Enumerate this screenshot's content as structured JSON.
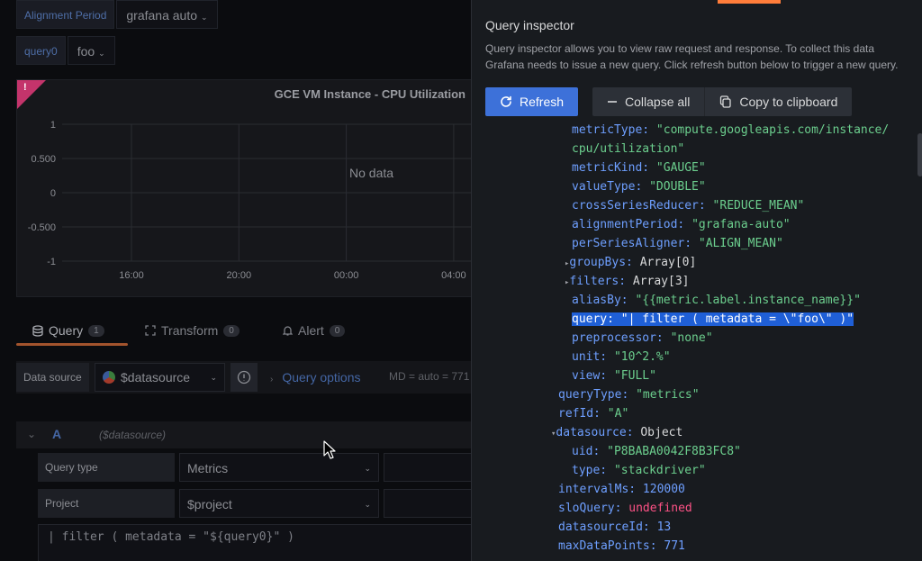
{
  "variables": {
    "alignment_label": "Alignment Period",
    "alignment_value": "grafana auto",
    "query_label": "query0",
    "query_value": "foo"
  },
  "panel": {
    "title": "GCE VM Instance - CPU Utilization",
    "corner_mark": "!",
    "no_data": "No data",
    "y_ticks": [
      "1",
      "0.500",
      "0",
      "-0.500",
      "-1"
    ],
    "x_ticks": [
      "16:00",
      "20:00",
      "00:00",
      "04:00"
    ]
  },
  "editor_tabs": [
    {
      "label": "Query",
      "count": "1"
    },
    {
      "label": "Transform",
      "count": "0"
    },
    {
      "label": "Alert",
      "count": "0"
    }
  ],
  "datasource_row": {
    "label": "Data source",
    "value": "$datasource",
    "query_options": "Query options",
    "meta": "MD = auto = 771"
  },
  "query_row": {
    "ref": "A",
    "datasource": "($datasource)",
    "query_type_label": "Query type",
    "query_type_value": "Metrics",
    "project_label": "Project",
    "project_value": "$project",
    "code": "| filter ( metadata = \"${query0}\" )"
  },
  "inspector": {
    "title": "Query inspector",
    "description": "Query inspector allows you to view raw request and response. To collect this data Grafana needs to issue a new query. Click refresh button below to trigger a new query.",
    "refresh_label": "Refresh",
    "collapse_label": "Collapse all",
    "copy_label": "Copy to clipboard",
    "accent_color": "#3d71d9"
  },
  "json_lines": [
    {
      "indent": 1,
      "key": "metricType",
      "value": "\"compute.googleapis.com/instance/",
      "type": "s"
    },
    {
      "indent": 1,
      "key": "",
      "value": "cpu/utilization\"",
      "type": "s"
    },
    {
      "indent": 1,
      "key": "metricKind",
      "value": "\"GAUGE\"",
      "type": "s"
    },
    {
      "indent": 1,
      "key": "valueType",
      "value": "\"DOUBLE\"",
      "type": "s"
    },
    {
      "indent": 1,
      "key": "crossSeriesReducer",
      "value": "\"REDUCE_MEAN\"",
      "type": "s"
    },
    {
      "indent": 1,
      "key": "alignmentPeriod",
      "value": "\"grafana-auto\"",
      "type": "s"
    },
    {
      "indent": 1,
      "key": "perSeriesAligner",
      "value": "\"ALIGN_MEAN\"",
      "type": "s"
    },
    {
      "indent": 1,
      "key": "groupBys",
      "value": "Array[0]",
      "type": "p",
      "toggle": "▸"
    },
    {
      "indent": 1,
      "key": "filters",
      "value": "Array[3]",
      "type": "p",
      "toggle": "▸"
    },
    {
      "indent": 1,
      "key": "aliasBy",
      "value": "\"{{metric.label.instance_name}}\"",
      "type": "s"
    },
    {
      "indent": 1,
      "key": "query",
      "value": "\"| filter ( metadata = \\\"foo\\\" )\"",
      "type": "s",
      "selected": true
    },
    {
      "indent": 1,
      "key": "preprocessor",
      "value": "\"none\"",
      "type": "s"
    },
    {
      "indent": 1,
      "key": "unit",
      "value": "\"10^2.%\"",
      "type": "s"
    },
    {
      "indent": 1,
      "key": "view",
      "value": "\"FULL\"",
      "type": "s"
    },
    {
      "indent": 0,
      "key": "queryType",
      "value": "\"metrics\"",
      "type": "s"
    },
    {
      "indent": 0,
      "key": "refId",
      "value": "\"A\"",
      "type": "s"
    },
    {
      "indent": 0,
      "key": "datasource",
      "value": "Object",
      "type": "p",
      "toggle": "▾"
    },
    {
      "indent": 1,
      "key": "uid",
      "value": "\"P8BABA0042F8B3FC8\"",
      "type": "s"
    },
    {
      "indent": 1,
      "key": "type",
      "value": "\"stackdriver\"",
      "type": "s"
    },
    {
      "indent": 0,
      "key": "intervalMs",
      "value": "120000",
      "type": "n"
    },
    {
      "indent": 0,
      "key": "sloQuery",
      "value": "undefined",
      "type": "u"
    },
    {
      "indent": 0,
      "key": "datasourceId",
      "value": "13",
      "type": "n"
    },
    {
      "indent": 0,
      "key": "maxDataPoints",
      "value": "771",
      "type": "n"
    }
  ]
}
